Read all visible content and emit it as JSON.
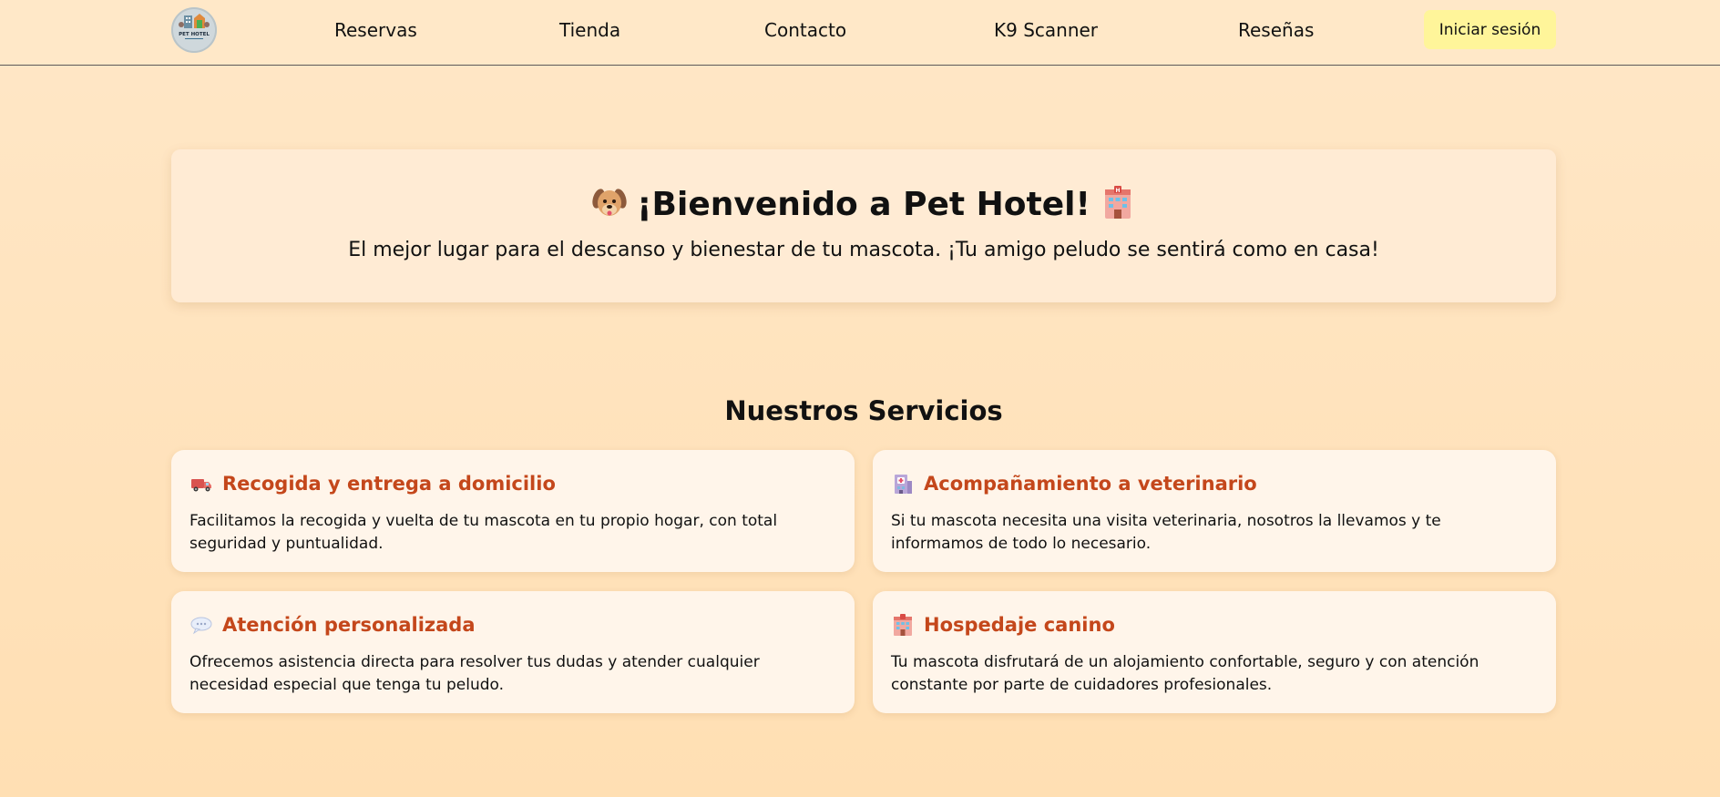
{
  "nav": {
    "links": [
      {
        "label": "Reservas"
      },
      {
        "label": "Tienda"
      },
      {
        "label": "Contacto"
      },
      {
        "label": "K9 Scanner"
      },
      {
        "label": "Reseñas"
      }
    ],
    "login_label": "Iniciar sesión",
    "logo": {
      "text": "PET HOTEL"
    }
  },
  "hero": {
    "title": "¡Bienvenido a Pet Hotel!",
    "subtitle": "El mejor lugar para el descanso y bienestar de tu mascota. ¡Tu amigo peludo se sentirá como en casa!"
  },
  "services": {
    "title": "Nuestros Servicios",
    "items": [
      {
        "icon": "delivery-truck-icon",
        "title": "Recogida y entrega a domicilio",
        "text": "Facilitamos la recogida y vuelta de tu mascota en tu propio hogar, con total seguridad y puntualidad."
      },
      {
        "icon": "hospital-icon",
        "title": "Acompañamiento a veterinario",
        "text": "Si tu mascota necesita una visita veterinaria, nosotros la llevamos y te informamos de todo lo necesario."
      },
      {
        "icon": "speech-bubble-icon",
        "title": "Atención personalizada",
        "text": "Ofrecemos asistencia directa para resolver tus dudas y atender cualquier necesidad especial que tenga tu peludo."
      },
      {
        "icon": "hotel-icon",
        "title": "Hospedaje canino",
        "text": "Tu mascota disfrutará de un alojamiento confortable, seguro y con atención constante por parte de cuidadores profesionales."
      }
    ]
  },
  "colors": {
    "background": "#ffe3bd",
    "accent_title": "#c4471b",
    "login_button": "#fff59a",
    "card": "#fff5ea"
  }
}
